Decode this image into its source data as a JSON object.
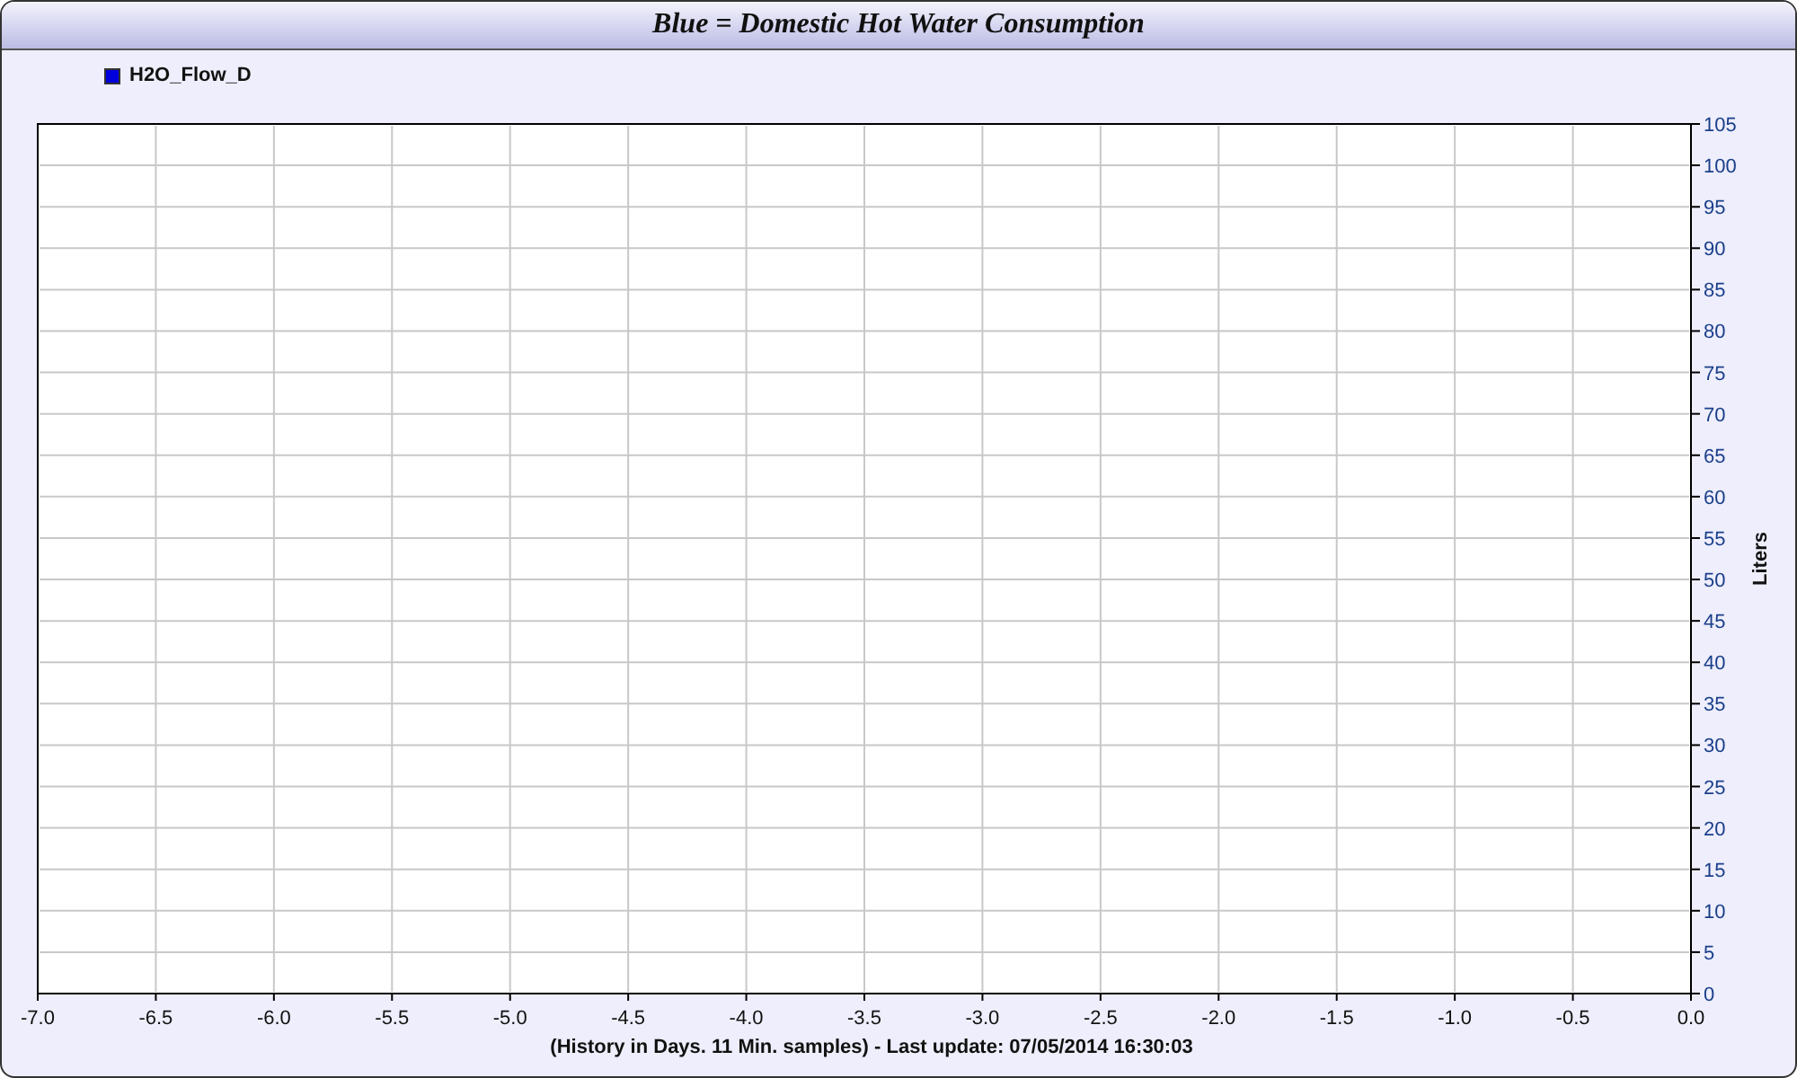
{
  "window": {
    "title": "Blue = Domestic Hot Water Consumption"
  },
  "chart": {
    "chart_data": {
      "type": "line",
      "xlabel": "(History in Days. 11 Min. samples) - Last update: 07/05/2014 16:30:03",
      "ylabel": "Liters",
      "series": [
        {
          "name": "H2O_Flow_D",
          "color": "#0000dd",
          "values": [
            null,
            null,
            null,
            null,
            null,
            null,
            null,
            null,
            null,
            null,
            null,
            null,
            null,
            null,
            null
          ]
        }
      ],
      "categories": [
        "-7.0",
        "-6.5",
        "-6.0",
        "-5.5",
        "-5.0",
        "-4.5",
        "-4.0",
        "-3.5",
        "-3.0",
        "-2.5",
        "-2.0",
        "-1.5",
        "-1.0",
        "-0.5",
        "0.0"
      ],
      "ylim": [
        0,
        105
      ],
      "grid": true,
      "yticks": [
        0,
        5,
        10,
        15,
        20,
        25,
        30,
        35,
        40,
        45,
        50,
        55,
        60,
        65,
        70,
        75,
        80,
        85,
        90,
        95,
        100,
        105
      ]
    }
  }
}
